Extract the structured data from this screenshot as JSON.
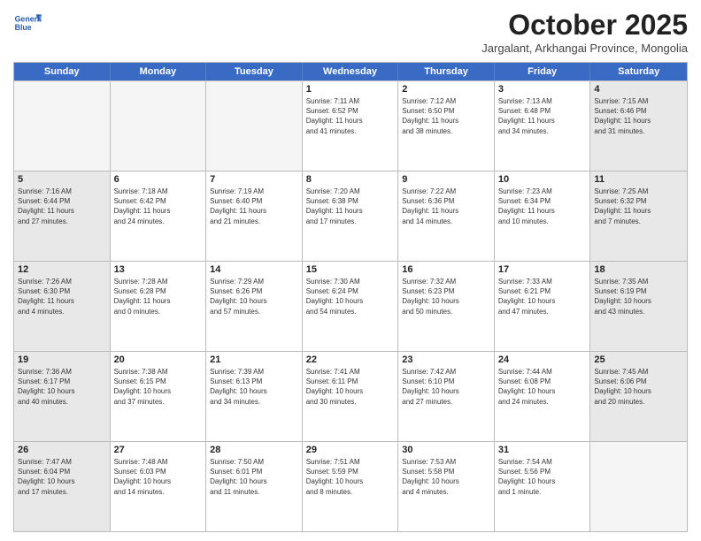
{
  "logo": {
    "line1": "General",
    "line2": "Blue"
  },
  "header": {
    "month": "October 2025",
    "location": "Jargalant, Arkhangai Province, Mongolia"
  },
  "weekdays": [
    "Sunday",
    "Monday",
    "Tuesday",
    "Wednesday",
    "Thursday",
    "Friday",
    "Saturday"
  ],
  "rows": [
    [
      {
        "num": "",
        "info": "",
        "empty": true
      },
      {
        "num": "",
        "info": "",
        "empty": true
      },
      {
        "num": "",
        "info": "",
        "empty": true
      },
      {
        "num": "1",
        "info": "Sunrise: 7:11 AM\nSunset: 6:52 PM\nDaylight: 11 hours\nand 41 minutes.",
        "empty": false
      },
      {
        "num": "2",
        "info": "Sunrise: 7:12 AM\nSunset: 6:50 PM\nDaylight: 11 hours\nand 38 minutes.",
        "empty": false
      },
      {
        "num": "3",
        "info": "Sunrise: 7:13 AM\nSunset: 6:48 PM\nDaylight: 11 hours\nand 34 minutes.",
        "empty": false
      },
      {
        "num": "4",
        "info": "Sunrise: 7:15 AM\nSunset: 6:46 PM\nDaylight: 11 hours\nand 31 minutes.",
        "empty": false,
        "shaded": true
      }
    ],
    [
      {
        "num": "5",
        "info": "Sunrise: 7:16 AM\nSunset: 6:44 PM\nDaylight: 11 hours\nand 27 minutes.",
        "empty": false,
        "shaded": true
      },
      {
        "num": "6",
        "info": "Sunrise: 7:18 AM\nSunset: 6:42 PM\nDaylight: 11 hours\nand 24 minutes.",
        "empty": false
      },
      {
        "num": "7",
        "info": "Sunrise: 7:19 AM\nSunset: 6:40 PM\nDaylight: 11 hours\nand 21 minutes.",
        "empty": false
      },
      {
        "num": "8",
        "info": "Sunrise: 7:20 AM\nSunset: 6:38 PM\nDaylight: 11 hours\nand 17 minutes.",
        "empty": false
      },
      {
        "num": "9",
        "info": "Sunrise: 7:22 AM\nSunset: 6:36 PM\nDaylight: 11 hours\nand 14 minutes.",
        "empty": false
      },
      {
        "num": "10",
        "info": "Sunrise: 7:23 AM\nSunset: 6:34 PM\nDaylight: 11 hours\nand 10 minutes.",
        "empty": false
      },
      {
        "num": "11",
        "info": "Sunrise: 7:25 AM\nSunset: 6:32 PM\nDaylight: 11 hours\nand 7 minutes.",
        "empty": false,
        "shaded": true
      }
    ],
    [
      {
        "num": "12",
        "info": "Sunrise: 7:26 AM\nSunset: 6:30 PM\nDaylight: 11 hours\nand 4 minutes.",
        "empty": false,
        "shaded": true
      },
      {
        "num": "13",
        "info": "Sunrise: 7:28 AM\nSunset: 6:28 PM\nDaylight: 11 hours\nand 0 minutes.",
        "empty": false
      },
      {
        "num": "14",
        "info": "Sunrise: 7:29 AM\nSunset: 6:26 PM\nDaylight: 10 hours\nand 57 minutes.",
        "empty": false
      },
      {
        "num": "15",
        "info": "Sunrise: 7:30 AM\nSunset: 6:24 PM\nDaylight: 10 hours\nand 54 minutes.",
        "empty": false
      },
      {
        "num": "16",
        "info": "Sunrise: 7:32 AM\nSunset: 6:23 PM\nDaylight: 10 hours\nand 50 minutes.",
        "empty": false
      },
      {
        "num": "17",
        "info": "Sunrise: 7:33 AM\nSunset: 6:21 PM\nDaylight: 10 hours\nand 47 minutes.",
        "empty": false
      },
      {
        "num": "18",
        "info": "Sunrise: 7:35 AM\nSunset: 6:19 PM\nDaylight: 10 hours\nand 43 minutes.",
        "empty": false,
        "shaded": true
      }
    ],
    [
      {
        "num": "19",
        "info": "Sunrise: 7:36 AM\nSunset: 6:17 PM\nDaylight: 10 hours\nand 40 minutes.",
        "empty": false,
        "shaded": true
      },
      {
        "num": "20",
        "info": "Sunrise: 7:38 AM\nSunset: 6:15 PM\nDaylight: 10 hours\nand 37 minutes.",
        "empty": false
      },
      {
        "num": "21",
        "info": "Sunrise: 7:39 AM\nSunset: 6:13 PM\nDaylight: 10 hours\nand 34 minutes.",
        "empty": false
      },
      {
        "num": "22",
        "info": "Sunrise: 7:41 AM\nSunset: 6:11 PM\nDaylight: 10 hours\nand 30 minutes.",
        "empty": false
      },
      {
        "num": "23",
        "info": "Sunrise: 7:42 AM\nSunset: 6:10 PM\nDaylight: 10 hours\nand 27 minutes.",
        "empty": false
      },
      {
        "num": "24",
        "info": "Sunrise: 7:44 AM\nSunset: 6:08 PM\nDaylight: 10 hours\nand 24 minutes.",
        "empty": false
      },
      {
        "num": "25",
        "info": "Sunrise: 7:45 AM\nSunset: 6:06 PM\nDaylight: 10 hours\nand 20 minutes.",
        "empty": false,
        "shaded": true
      }
    ],
    [
      {
        "num": "26",
        "info": "Sunrise: 7:47 AM\nSunset: 6:04 PM\nDaylight: 10 hours\nand 17 minutes.",
        "empty": false,
        "shaded": true
      },
      {
        "num": "27",
        "info": "Sunrise: 7:48 AM\nSunset: 6:03 PM\nDaylight: 10 hours\nand 14 minutes.",
        "empty": false
      },
      {
        "num": "28",
        "info": "Sunrise: 7:50 AM\nSunset: 6:01 PM\nDaylight: 10 hours\nand 11 minutes.",
        "empty": false
      },
      {
        "num": "29",
        "info": "Sunrise: 7:51 AM\nSunset: 5:59 PM\nDaylight: 10 hours\nand 8 minutes.",
        "empty": false
      },
      {
        "num": "30",
        "info": "Sunrise: 7:53 AM\nSunset: 5:58 PM\nDaylight: 10 hours\nand 4 minutes.",
        "empty": false
      },
      {
        "num": "31",
        "info": "Sunrise: 7:54 AM\nSunset: 5:56 PM\nDaylight: 10 hours\nand 1 minute.",
        "empty": false
      },
      {
        "num": "",
        "info": "",
        "empty": true,
        "shaded": true
      }
    ]
  ]
}
